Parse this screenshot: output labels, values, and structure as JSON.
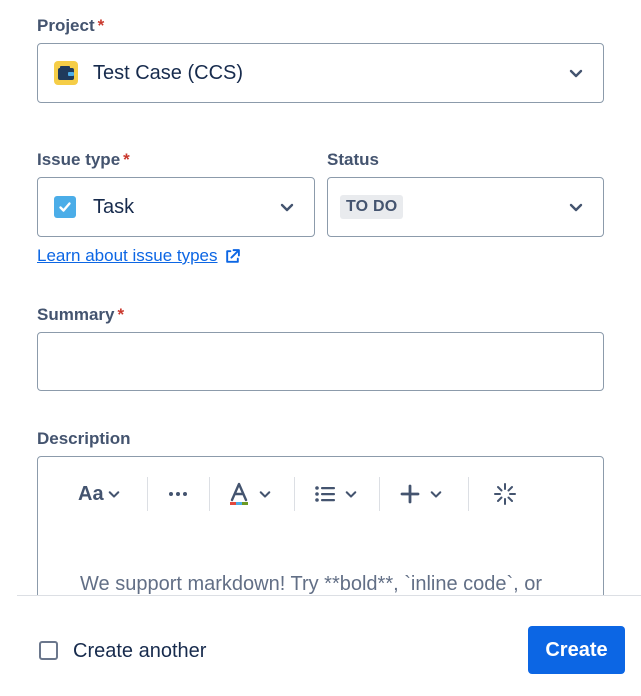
{
  "project": {
    "label": "Project",
    "required_mark": "*",
    "value": "Test Case (CCS)"
  },
  "issue_type": {
    "label": "Issue type",
    "required_mark": "*",
    "value": "Task"
  },
  "status": {
    "label": "Status",
    "value": "TO DO"
  },
  "learn_link": "Learn about issue types",
  "summary": {
    "label": "Summary",
    "required_mark": "*",
    "value": ""
  },
  "description": {
    "label": "Description",
    "toolbar": {
      "text_style": "Aa"
    },
    "placeholder": "We support markdown! Try **bold**, `inline code`, or"
  },
  "footer": {
    "create_another": "Create another",
    "create_button": "Create"
  },
  "colors": {
    "primary": "#0c66e4",
    "required": "#c9372c",
    "project_icon": "#f5cd47",
    "task_icon": "#4bade8"
  }
}
